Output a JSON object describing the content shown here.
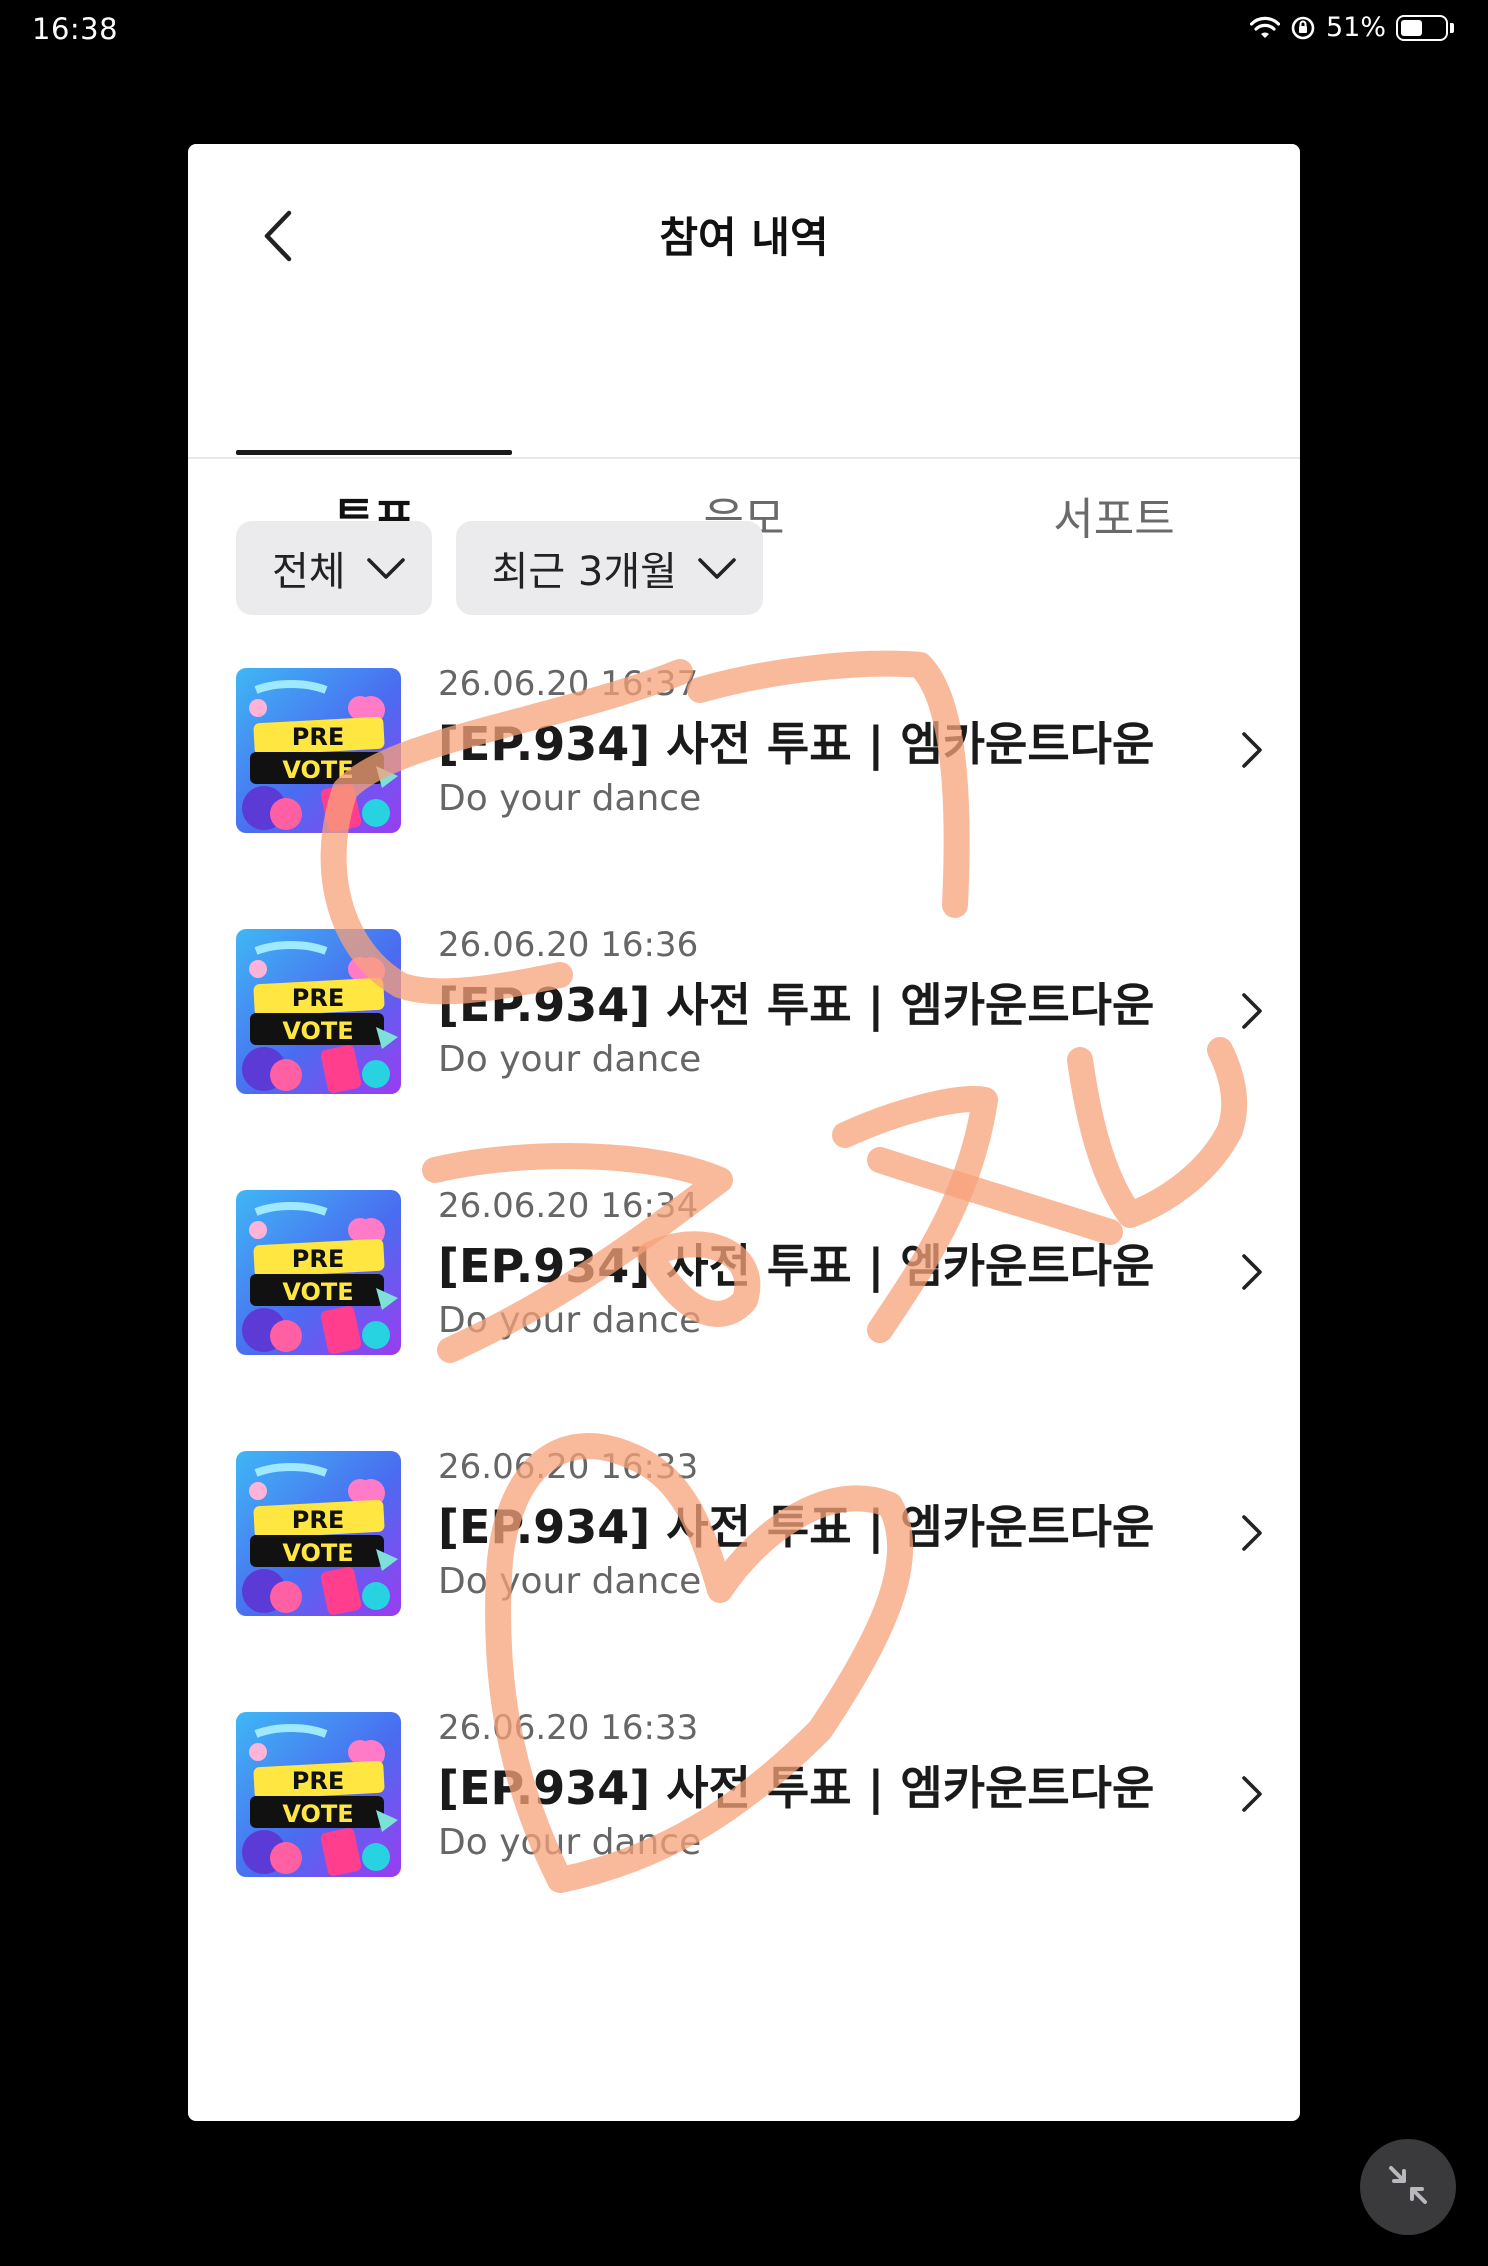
{
  "status_bar": {
    "time": "16:38",
    "battery_percent": "51%",
    "battery_level": 0.51
  },
  "header": {
    "title": "참여 내역"
  },
  "tabs": [
    {
      "label": "투표",
      "active": true
    },
    {
      "label": "응모",
      "active": false
    },
    {
      "label": "서포트",
      "active": false
    }
  ],
  "filters": {
    "type_label": "전체",
    "period_label": "최근 3개월"
  },
  "items": [
    {
      "date": "26.06.20 16:37",
      "title": "[EP.934] 사전 투표 | 엠카운트다운",
      "subtitle": "Do your dance"
    },
    {
      "date": "26.06.20 16:36",
      "title": "[EP.934] 사전 투표 | 엠카운트다운",
      "subtitle": "Do your dance"
    },
    {
      "date": "26.06.20 16:34",
      "title": "[EP.934] 사전 투표 | 엠카운트다운",
      "subtitle": "Do your dance"
    },
    {
      "date": "26.06.20 16:33",
      "title": "[EP.934] 사전 투표 | 엠카운트다운",
      "subtitle": "Do your dance"
    },
    {
      "date": "26.06.20 16:33",
      "title": "[EP.934] 사전 투표 | 엠카운트다운",
      "subtitle": "Do your dance"
    }
  ],
  "thumbnail": {
    "line1": "PRE",
    "line2": "VOTE"
  },
  "colors": {
    "scribble": "#f7a27a",
    "thumb_bg": "#4a6cf0",
    "thumb_label": "#ffe640"
  }
}
